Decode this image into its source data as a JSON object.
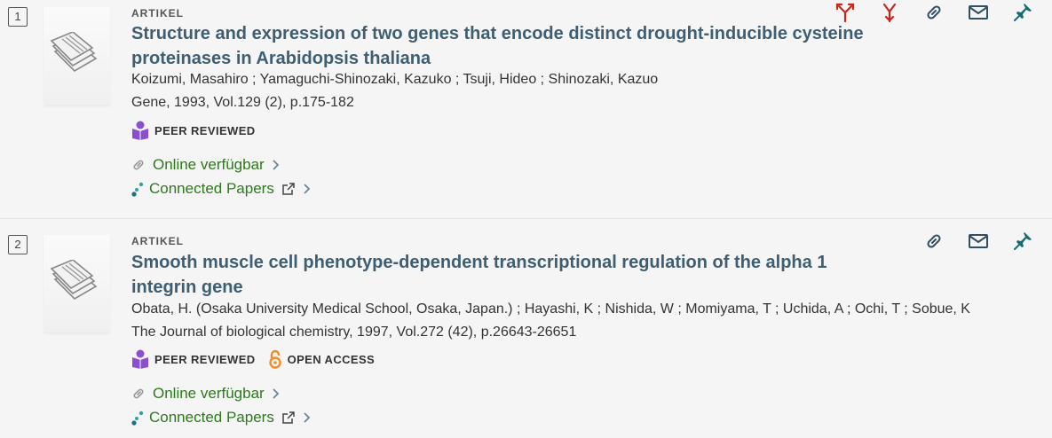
{
  "results": [
    {
      "index": "1",
      "type": "ARTIKEL",
      "title": "Structure and expression of two genes that encode distinct drought-inducible cysteine proteinases in Arabidopsis thaliana",
      "authors": "Koizumi, Masahiro ; Yamaguchi-Shinozaki, Kazuko ; Tsuji, Hideo ; Shinozaki, Kazuo",
      "source": "Gene, 1993, Vol.129 (2), p.175-182",
      "peer_reviewed": "PEER REVIEWED",
      "online": "Online verfügbar",
      "connected": "Connected Papers"
    },
    {
      "index": "2",
      "type": "ARTIKEL",
      "title": "Smooth muscle cell phenotype-dependent transcriptional regulation of the alpha 1 integrin gene",
      "authors": "Obata, H. (Osaka University Medical School, Osaka, Japan.) ; Hayashi, K ; Nishida, W ; Momiyama, T ; Uchida, A ; Ochi, T ; Sobue, K",
      "source": "The Journal of biological chemistry, 1997, Vol.272 (42), p.26643-26651",
      "peer_reviewed": "PEER REVIEWED",
      "open_access": "OPEN ACCESS",
      "online": "Online verfügbar",
      "connected": "Connected Papers"
    }
  ],
  "icons": {
    "thumbnail": "document-thumbnail-icon",
    "peer_reviewed": "peer-reviewed-icon",
    "open_access": "open-access-lock-icon",
    "link": "link-icon",
    "external": "external-link-icon",
    "chevron": "chevron-right-icon",
    "connected_papers": "connected-papers-icon",
    "cited_by": "cited-by-icon",
    "citing": "citing-icon",
    "permalink": "permalink-icon",
    "email": "email-icon",
    "pin": "pin-icon"
  },
  "colors": {
    "title": "#3e5f73",
    "link_green": "#2c7a1a",
    "peer_reviewed_purple": "#8a4fd0",
    "open_access_orange": "#f28c28",
    "citation_red": "#c9261c",
    "action_blue": "#2f4f63",
    "pin_teal": "#166b74"
  }
}
